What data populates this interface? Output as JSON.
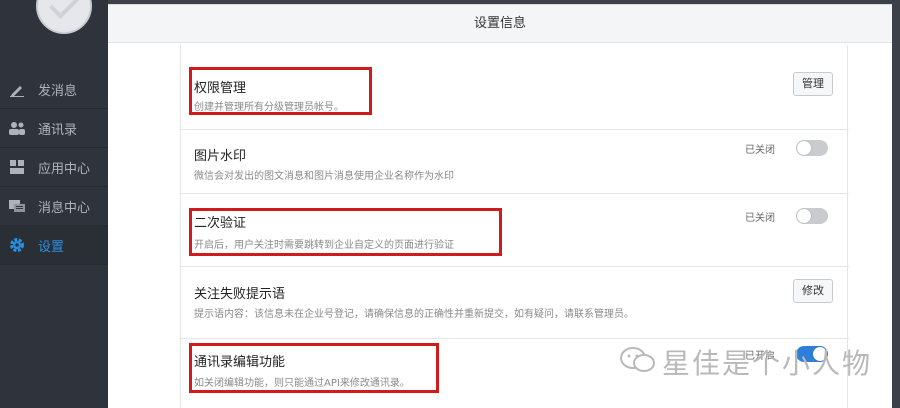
{
  "sidebar": {
    "items": [
      {
        "label": "发消息",
        "icon": "pencil-icon"
      },
      {
        "label": "通讯录",
        "icon": "contacts-icon"
      },
      {
        "label": "应用中心",
        "icon": "apps-icon"
      },
      {
        "label": "消息中心",
        "icon": "message-center-icon"
      },
      {
        "label": "设置",
        "icon": "gear-icon",
        "active": true
      }
    ]
  },
  "panel": {
    "title": "设置信息"
  },
  "settings": [
    {
      "title": "权限管理",
      "desc": "创建并管理所有分级管理员帐号。",
      "button": "管理"
    },
    {
      "title": "图片水印",
      "desc": "微信会对发出的图文消息和图片消息使用企业名称作为水印",
      "status": "已关闭",
      "toggle": false
    },
    {
      "title": "二次验证",
      "desc": "开启后，用户关注时需要跳转到企业自定义的页面进行验证",
      "status": "已关闭",
      "toggle": false
    },
    {
      "title": "关注失败提示语",
      "desc": "提示语内容：该信息未在企业号登记，请确保信息的正确性并重新提交，如有疑问，请联系管理员。",
      "button": "修改"
    },
    {
      "title": "通讯录编辑功能",
      "desc": "如关闭编辑功能，则只能通过API来修改通讯录。",
      "status": "已开启",
      "toggle": true
    }
  ],
  "watermark": {
    "text": "星佳是个小人物",
    "icon": "wechat-icon"
  },
  "colors": {
    "highlight": "#d11b1b",
    "accent": "#2a8fe0",
    "toggle_on": "#2e7fd8"
  }
}
